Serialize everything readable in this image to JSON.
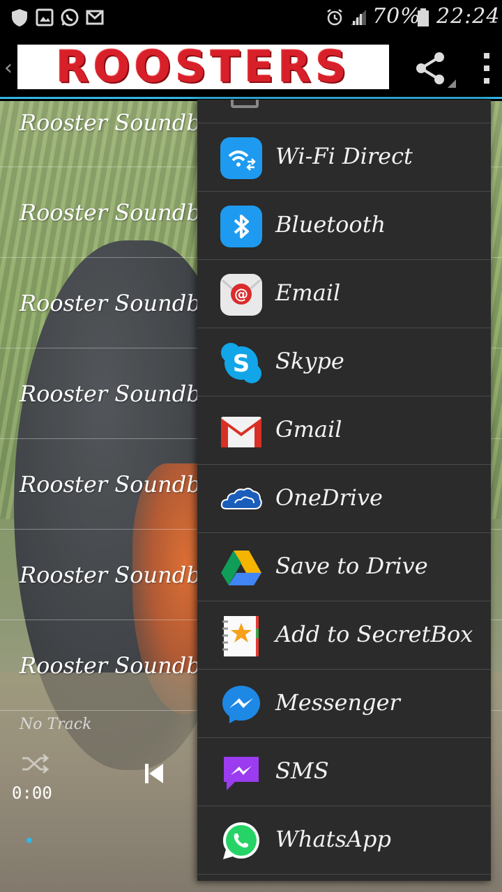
{
  "status_bar": {
    "battery": "70%",
    "time": "22:24"
  },
  "action_bar": {
    "logo_text": "ROOSTERS"
  },
  "list": {
    "items": [
      "Rooster Soundbo",
      "Rooster Soundbo",
      "Rooster Soundbo",
      "Rooster Soundbo",
      "Rooster Soundbo",
      "Rooster Soundbo",
      "Rooster Soundbo"
    ]
  },
  "player": {
    "track": "No Track",
    "time": "0:00"
  },
  "share_menu": {
    "items": [
      {
        "label": "Wi-Fi Direct",
        "icon": "wifi-direct-icon"
      },
      {
        "label": "Bluetooth",
        "icon": "bluetooth-icon"
      },
      {
        "label": "Email",
        "icon": "email-icon"
      },
      {
        "label": "Skype",
        "icon": "skype-icon"
      },
      {
        "label": "Gmail",
        "icon": "gmail-icon"
      },
      {
        "label": "OneDrive",
        "icon": "onedrive-icon"
      },
      {
        "label": "Save to Drive",
        "icon": "drive-icon"
      },
      {
        "label": "Add to SecretBox",
        "icon": "secretbox-icon"
      },
      {
        "label": "Messenger",
        "icon": "messenger-icon"
      },
      {
        "label": "SMS",
        "icon": "sms-icon"
      },
      {
        "label": "WhatsApp",
        "icon": "whatsapp-icon"
      }
    ]
  },
  "colors": {
    "accent": "#33b5e5",
    "logo_red": "#d8202a",
    "popup_bg": "#2b2b2b"
  }
}
